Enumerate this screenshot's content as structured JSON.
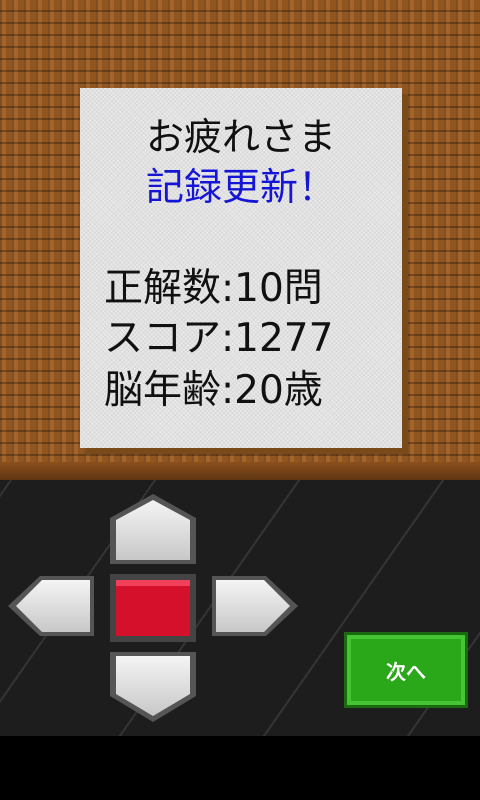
{
  "result": {
    "title": "お疲れさま",
    "record": "記録更新！",
    "correct_label": "正解数",
    "correct_value": "10問",
    "score_label": "スコア",
    "score_value": "1277",
    "brain_age_label": "脳年齢",
    "brain_age_value": "20歳",
    "separator": ":"
  },
  "controls": {
    "next_label": "次へ"
  },
  "colors": {
    "record_text": "#1515d6",
    "center_button": "#d4102a",
    "next_button": "#2aa81a"
  }
}
